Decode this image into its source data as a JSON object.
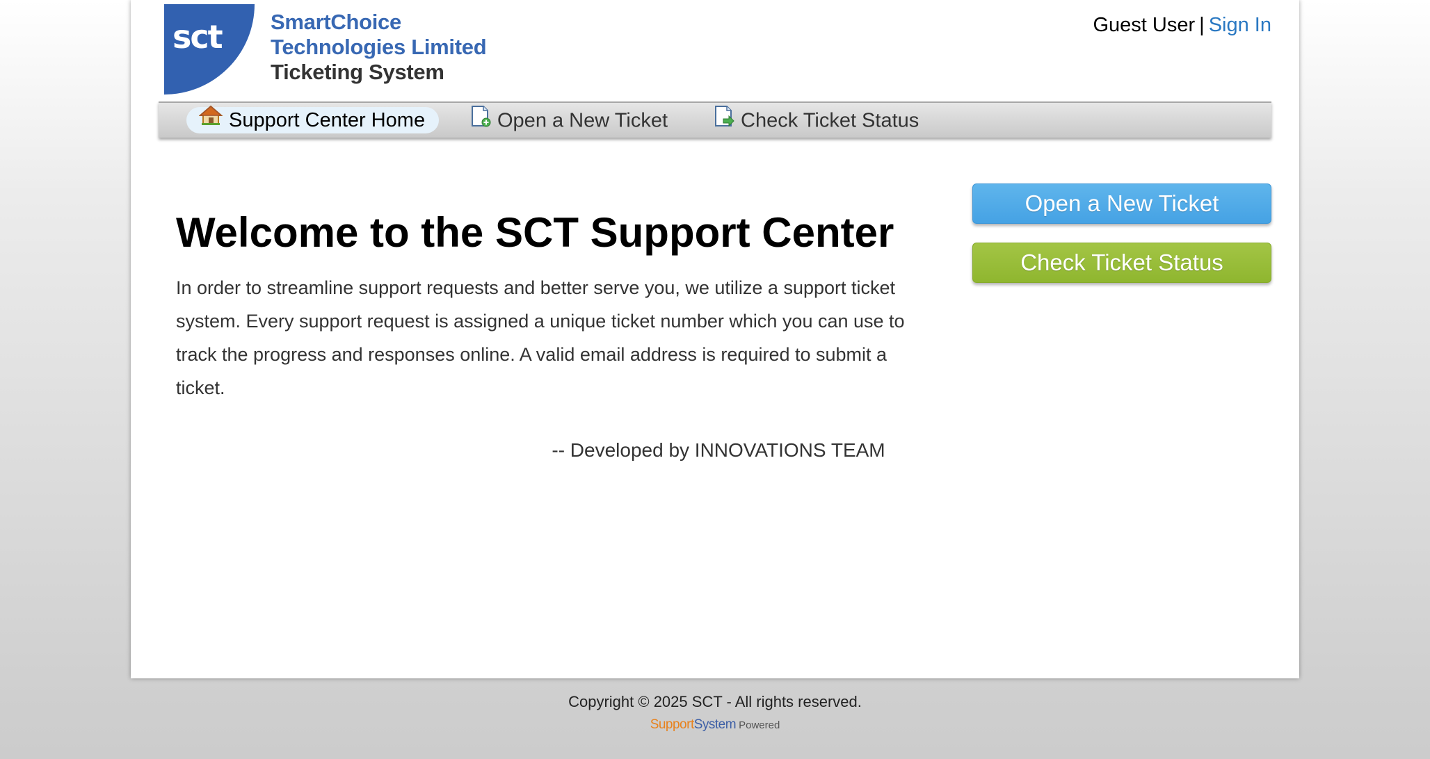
{
  "header": {
    "logo_text": "sct",
    "brand_line1": "SmartChoice",
    "brand_line2": "Technologies Limited",
    "brand_line3": "Ticketing System",
    "user_label": "Guest User",
    "separator": "|",
    "sign_in": "Sign In"
  },
  "nav": {
    "items": [
      {
        "label": "Support Center Home",
        "icon": "home-icon",
        "active": true
      },
      {
        "label": "Open a New Ticket",
        "icon": "new-ticket-icon",
        "active": false
      },
      {
        "label": "Check Ticket Status",
        "icon": "ticket-status-icon",
        "active": false
      }
    ]
  },
  "main": {
    "title": "Welcome to the SCT Support Center",
    "intro": "In order to streamline support requests and better serve you, we utilize a support ticket system. Every support request is assigned a unique ticket number which you can use to track the progress and responses online. A valid email address is required to submit a ticket.",
    "credit": "-- Developed by INNOVATIONS TEAM"
  },
  "sidebar": {
    "open_button": "Open a New Ticket",
    "status_button": "Check Ticket Status"
  },
  "footer": {
    "copyright": "Copyright © 2025 SCT - All rights reserved.",
    "powered_part1": "Support",
    "powered_part2": "System",
    "powered_part3": "Powered"
  },
  "colors": {
    "brand_blue": "#3261b0",
    "link_blue": "#2a78c2",
    "button_blue": "#4aa6e6",
    "button_green": "#97bc38"
  }
}
